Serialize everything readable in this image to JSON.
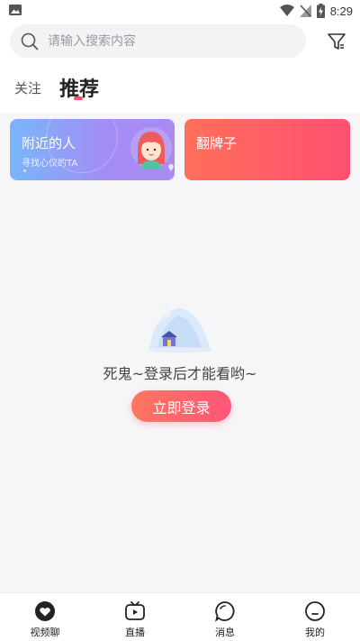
{
  "status_bar": {
    "time": "8:29"
  },
  "search": {
    "placeholder": "请输入搜索内容",
    "value": ""
  },
  "tabs": [
    {
      "label": "关注",
      "active": false
    },
    {
      "label": "推荐",
      "active": true
    }
  ],
  "cards": {
    "nearby": {
      "title": "附近的人",
      "subtitle": "寻找心仪的TA"
    },
    "flip": {
      "title": "翻牌子"
    }
  },
  "empty_state": {
    "message": "死鬼~登录后才能看哟~",
    "login_button": "立即登录"
  },
  "bottom_nav": [
    {
      "label": "视频聊",
      "icon": "heart-icon",
      "active": true
    },
    {
      "label": "直播",
      "icon": "tv-icon",
      "active": false
    },
    {
      "label": "消息",
      "icon": "chat-bubble-icon",
      "active": false
    },
    {
      "label": "我的",
      "icon": "profile-face-icon",
      "active": false
    }
  ],
  "colors": {
    "accent": "#ff5678",
    "background": "#f6f6f9",
    "nearby_gradient": [
      "#78b6f8",
      "#a98bf2"
    ],
    "flip_gradient": [
      "#ff6e5a",
      "#ff5071"
    ]
  }
}
